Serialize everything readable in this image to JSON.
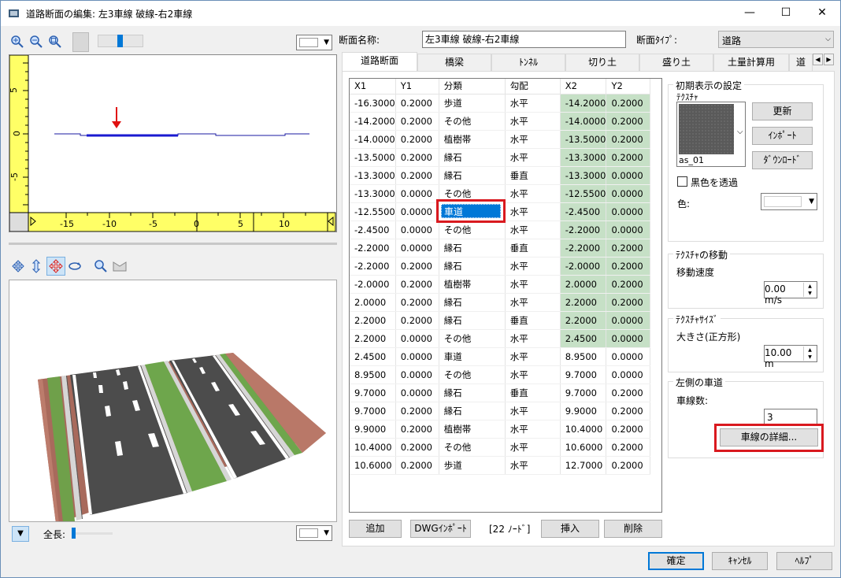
{
  "window": {
    "title": "道路断面の編集: 左3車線 破線-右2車線",
    "minimize": "—",
    "maximize": "☐",
    "close": "✕"
  },
  "left": {
    "ruler_v_labels": [
      "5",
      "0",
      "-5"
    ],
    "ruler_h_labels": [
      "-15",
      "-10",
      "-5",
      "0",
      "5",
      "10"
    ],
    "bottom_label": "全長:"
  },
  "form": {
    "section_name_label": "断面名称:",
    "section_name_value": "左3車線 破線-右2車線",
    "section_type_label": "断面ﾀｲﾌﾟ:",
    "section_type_value": "道路"
  },
  "tabs": [
    "道路断面",
    "橋梁",
    "ﾄﾝﾈﾙ",
    "切り土",
    "盛り土",
    "土量計算用",
    "道"
  ],
  "grid": {
    "headers": [
      "X1",
      "Y1",
      "分類",
      "勾配",
      "X2",
      "Y2"
    ],
    "rows": [
      [
        "-16.3000",
        "0.2000",
        "歩道",
        "水平",
        "-14.2000",
        "0.2000"
      ],
      [
        "-14.2000",
        "0.2000",
        "その他",
        "水平",
        "-14.0000",
        "0.2000"
      ],
      [
        "-14.0000",
        "0.2000",
        "植樹帯",
        "水平",
        "-13.5000",
        "0.2000"
      ],
      [
        "-13.5000",
        "0.2000",
        "縁石",
        "水平",
        "-13.3000",
        "0.2000"
      ],
      [
        "-13.3000",
        "0.2000",
        "縁石",
        "垂直",
        "-13.3000",
        "0.0000"
      ],
      [
        "-13.3000",
        "0.0000",
        "その他",
        "水平",
        "-12.5500",
        "0.0000"
      ],
      [
        "-12.5500",
        "0.0000",
        "車道",
        "水平",
        "-2.4500",
        "0.0000"
      ],
      [
        "-2.4500",
        "0.0000",
        "その他",
        "水平",
        "-2.2000",
        "0.0000"
      ],
      [
        "-2.2000",
        "0.0000",
        "縁石",
        "垂直",
        "-2.2000",
        "0.2000"
      ],
      [
        "-2.2000",
        "0.2000",
        "縁石",
        "水平",
        "-2.0000",
        "0.2000"
      ],
      [
        "-2.0000",
        "0.2000",
        "植樹帯",
        "水平",
        "2.0000",
        "0.2000"
      ],
      [
        "2.0000",
        "0.2000",
        "縁石",
        "水平",
        "2.2000",
        "0.2000"
      ],
      [
        "2.2000",
        "0.2000",
        "縁石",
        "垂直",
        "2.2000",
        "0.0000"
      ],
      [
        "2.2000",
        "0.0000",
        "その他",
        "水平",
        "2.4500",
        "0.0000"
      ],
      [
        "2.4500",
        "0.0000",
        "車道",
        "水平",
        "8.9500",
        "0.0000"
      ],
      [
        "8.9500",
        "0.0000",
        "その他",
        "水平",
        "9.7000",
        "0.0000"
      ],
      [
        "9.7000",
        "0.0000",
        "縁石",
        "垂直",
        "9.7000",
        "0.2000"
      ],
      [
        "9.7000",
        "0.2000",
        "縁石",
        "水平",
        "9.9000",
        "0.2000"
      ],
      [
        "9.9000",
        "0.2000",
        "植樹帯",
        "水平",
        "10.4000",
        "0.2000"
      ],
      [
        "10.4000",
        "0.2000",
        "その他",
        "水平",
        "10.6000",
        "0.2000"
      ],
      [
        "10.6000",
        "0.2000",
        "歩道",
        "水平",
        "12.7000",
        "0.2000"
      ]
    ],
    "selected_cell": "車道"
  },
  "grid_buttons": {
    "add": "追加",
    "dwg_import": "DWGｲﾝﾎﾟｰﾄ",
    "node_count": "[22 ﾉｰﾄﾞ]",
    "insert": "挿入",
    "delete": "削除"
  },
  "initial_display": {
    "legend": "初期表示の設定",
    "texture_label": "ﾃｸｽﾁｬ",
    "texture_name": "as_01",
    "update": "更新",
    "import": "ｲﾝﾎﾟｰﾄ",
    "download": "ﾀﾞｳﾝﾛｰﾄﾞ",
    "black_transparent": "黒色を透過",
    "color_label": "色:"
  },
  "texture_move": {
    "legend": "ﾃｸｽﾁｬの移動",
    "speed_label": "移動速度",
    "speed_value": "0.00 m/s"
  },
  "texture_size": {
    "legend": "ﾃｸｽﾁｬｻｲｽﾞ",
    "size_label": "大きさ(正方形)",
    "size_value": "10.00 m"
  },
  "left_lanes": {
    "legend": "左側の車道",
    "lane_count_label": "車線数:",
    "lane_count_value": "3",
    "details_button": "車線の詳細..."
  },
  "dialog_buttons": {
    "ok": "確定",
    "cancel": "ｷｬﾝｾﾙ",
    "help": "ﾍﾙﾌﾟ"
  },
  "colors": {
    "accent": "#0078d7",
    "highlight_red": "#d9191f",
    "readonly_green": "#c6e0c6",
    "ruler_yellow": "#ffff66"
  }
}
